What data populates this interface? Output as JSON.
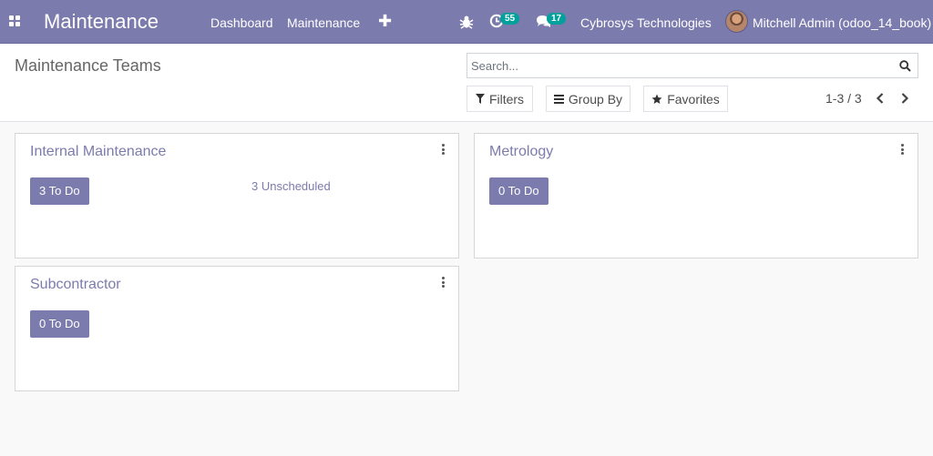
{
  "navbar": {
    "app_title": "Maintenance",
    "menu": [
      "Dashboard",
      "Maintenance"
    ],
    "activity_count": "55",
    "messages_count": "17",
    "company": "Cybrosys Technologies",
    "user": "Mitchell Admin (odoo_14_book)"
  },
  "control_panel": {
    "title": "Maintenance Teams",
    "search_placeholder": "Search...",
    "filters_label": "Filters",
    "group_by_label": "Group By",
    "favorites_label": "Favorites",
    "pager": "1-3 / 3"
  },
  "teams": [
    {
      "name": "Internal Maintenance",
      "todo": "3 To Do",
      "unscheduled": "3 Unscheduled"
    },
    {
      "name": "Metrology",
      "todo": "0 To Do"
    },
    {
      "name": "Subcontractor",
      "todo": "0 To Do"
    }
  ],
  "colors": {
    "brand": "#7c7bad",
    "badge": "#00a09d"
  }
}
